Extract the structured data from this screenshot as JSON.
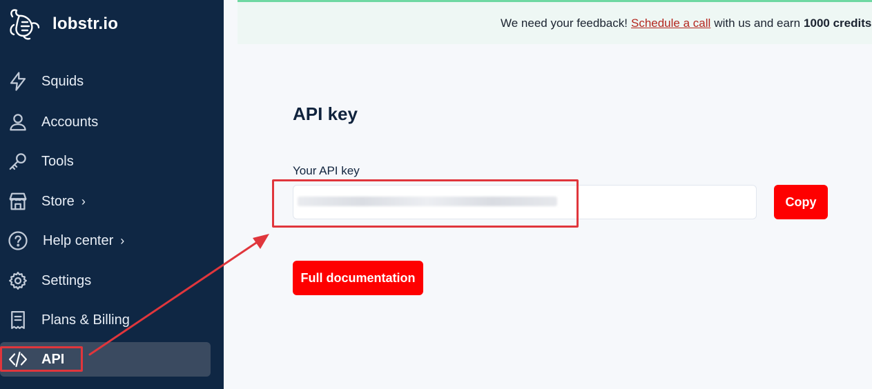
{
  "brand": {
    "name": "lobstr.io",
    "logo_icon": "lobster-logo-icon"
  },
  "sidebar": {
    "items": [
      {
        "label": "Squids",
        "icon": "lightning-icon"
      },
      {
        "label": "Accounts",
        "icon": "user-icon"
      },
      {
        "label": "Tools",
        "icon": "key-icon"
      },
      {
        "label": "Store",
        "icon": "store-icon",
        "chevron": "›"
      },
      {
        "label": "Help center",
        "icon": "help-circle-icon",
        "chevron": "›"
      },
      {
        "label": "Settings",
        "icon": "gear-icon"
      },
      {
        "label": "Plans & Billing",
        "icon": "receipt-icon"
      },
      {
        "label": "API",
        "icon": "code-icon",
        "active": true
      }
    ]
  },
  "banner": {
    "prefix": "We need your feedback!",
    "link": "Schedule a call",
    "middle": "with us and earn",
    "bold": "1000 credits"
  },
  "main": {
    "title": "API key",
    "field_label": "Your API key",
    "copy_label": "Copy",
    "doc_label": "Full documentation"
  },
  "colors": {
    "sidebar_bg": "#0f2744",
    "accent_red": "#fe0000",
    "annotation_red": "#e0363c",
    "banner_border": "#6ed8a2"
  }
}
